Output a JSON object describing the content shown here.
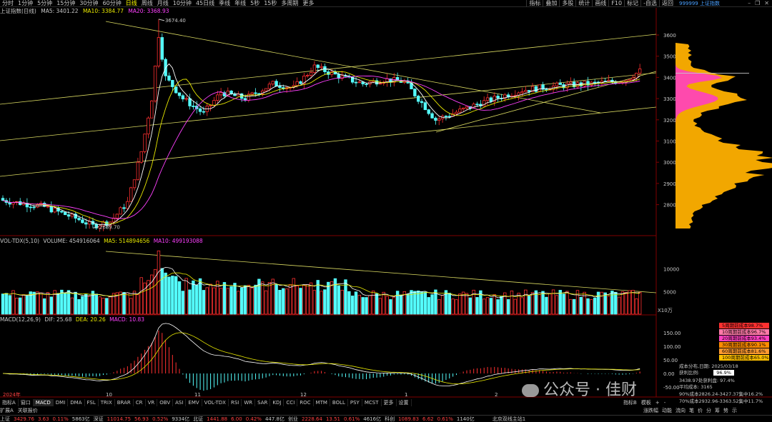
{
  "toolbar": {
    "timeframes": [
      "分时",
      "1分钟",
      "5分钟",
      "15分钟",
      "30分钟",
      "60分钟",
      "日线",
      "周线",
      "月线",
      "10分钟",
      "45日线",
      "季线",
      "年线",
      "5秒",
      "15秒",
      "多周期",
      "更多"
    ],
    "active": "日线",
    "right_buttons": [
      "指标",
      "叠加",
      "多股",
      "统计",
      "画线",
      "F10",
      "标记",
      "-自选",
      "返回"
    ],
    "symbol": "999999 上证指数"
  },
  "main_title": {
    "name": "上证指数(日线)",
    "ma5_label": "MA5: 3401.22",
    "ma10_label": "MA10: 3384.77",
    "ma20_label": "MA20: 3368.93"
  },
  "price_axis": [
    "3600",
    "3500",
    "3400",
    "3300",
    "3200",
    "3100",
    "3000",
    "2900",
    "2800"
  ],
  "annotations": {
    "high": "3674.40",
    "low": "2689.70"
  },
  "vol_title": {
    "name": "VOL-TDX(5,10)",
    "volume": "VOLUME: 454916064",
    "ma5": "MA5: 514894656",
    "ma10": "MA10: 499193088"
  },
  "vol_axis": [
    "10000",
    "5000",
    "X10万"
  ],
  "macd_title": {
    "name": "MACD(12,26,9)",
    "dif": "DIF: 25.68",
    "dea": "DEA: 20.26",
    "macd": "MACD: 10.83"
  },
  "macd_axis": [
    "150.00",
    "100.00",
    "50.00",
    "0.00",
    "-50.00"
  ],
  "date_axis": [
    "2024年",
    "10",
    "11",
    "12",
    "1",
    "2"
  ],
  "indicator_tabs": [
    "指标A",
    "窗口",
    "MACD",
    "DMI",
    "DMA",
    "FSL",
    "TRIX",
    "BRAR",
    "CR",
    "VR",
    "OBV",
    "ASI",
    "EMV",
    "VOL-TDX",
    "RSI",
    "WR",
    "SAR",
    "KDJ",
    "CCI",
    "ROC",
    "MTM",
    "BOLL",
    "PSY",
    "MCST",
    "更多",
    "设置"
  ],
  "bottom_left": [
    "扩展A",
    "关联报价"
  ],
  "status_items": [
    {
      "name": "上证",
      "value": "3429.76",
      "chg": "3.63",
      "pct": "0.11%",
      "vol": "5863亿"
    },
    {
      "name": "深证",
      "value": "11014.75",
      "chg": "56.93",
      "pct": "0.52%",
      "vol": "9334亿"
    },
    {
      "name": "北证",
      "value": "1441.88",
      "chg": "6.00",
      "pct": "0.42%",
      "vol": "447.8亿"
    },
    {
      "name": "创业",
      "value": "2228.64",
      "chg": "13.51",
      "pct": "0.61%",
      "vol": "4616亿"
    },
    {
      "name": "科创",
      "value": "1089.83",
      "chg": "6.62",
      "pct": "0.61%",
      "vol": "1140亿"
    }
  ],
  "server": "北京双线主站1",
  "right_bottom": [
    "指标B",
    "模板",
    "+",
    "-"
  ],
  "right_bottom2": [
    "涨跌幅",
    "动能",
    "流向",
    "笔",
    "价",
    "分",
    "筹",
    "势",
    "示"
  ],
  "cost_legend": [
    {
      "label": "5周期前成本98.7%",
      "color": "#ff3030"
    },
    {
      "label": "10周期前成本96.7%",
      "color": "#ff7aa8"
    },
    {
      "label": "20周期前成本93.4%",
      "color": "#ff40c0"
    },
    {
      "label": "30周期前成本90.1%",
      "color": "#ff8c00"
    },
    {
      "label": "60周期前成本81.6%",
      "color": "#ff9a30"
    },
    {
      "label": "100周期前成本65.0%",
      "color": "#ffc000"
    }
  ],
  "cost_info": {
    "date_line": "成本分布,日期: 2025/03/18",
    "profit_label": "获利比例:",
    "profit_value": "96.9%",
    "line1": "3438.97处获利盘: 97.4%",
    "line2": "平均成本: 3165",
    "line3": "90%成本2826.24-3427.37集中16.2%",
    "line4": "70%成本2932.96-3363.52集中11.7%"
  },
  "watermark": "公众号 · 佳财"
}
